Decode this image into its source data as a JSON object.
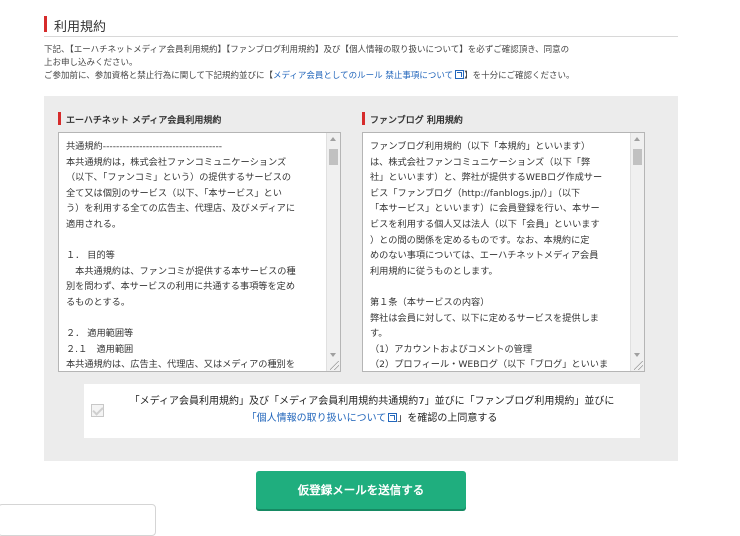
{
  "section": {
    "title": "利用規約"
  },
  "notice": {
    "line1": "下記、【エーハチネットメディア会員利用規約】【ファンブログ利用規約】及び【個人情報の取り扱いについて】を必ずご確認頂き、同意の",
    "line2": "上お申し込みください。",
    "line3_prefix": "ご参加前に、参加資格と禁止行為に関して下記規約並びに【",
    "line3_link": "メディア会員としてのルール 禁止事項について",
    "line3_suffix": "】を十分にご確認ください。"
  },
  "terms_left": {
    "heading": "エーハチネット メディア会員利用規約",
    "body": "共通規約------------------------------------\n本共通規約は，株式会社ファンコミュニケーションズ\n（以下、「ファンコミ」という）の提供するサービスの\n全て又は個別のサービス（以下、「本サービス」とい\nう）を利用する全ての広告主、代理店、及びメディアに\n適用される。\n\n１． 目的等\n　本共通規約は、ファンコミが提供する本サービスの種\n別を問わず、本サービスの利用に共通する事項等を定め\nるものとする。\n\n２． 適用範囲等\n２.１　適用範囲\n本共通規約は、広告主、代理店、又はメディアの種別を\n問わず本サービスの一切の利用者（以下、「利用者」と"
  },
  "terms_right": {
    "heading": "ファンブログ 利用規約",
    "body": "ファンブログ利用規約（以下「本規約」といいます）\nは、株式会社ファンコミュニケーションズ（以下「弊\n社」といいます）と、弊社が提供するWEBログ作成サー\nビス「ファンブログ（http://fanblogs.jp/）」（以下\n「本サービス」といいます）に会員登録を行い、本サー\nビスを利用する個人又は法人（以下「会員」といいます\n）との間の関係を定めるものです。なお、本規約に定\nめのない事項については、エーハチネットメディア会員\n利用規約に従うものとします。\n\n第１条（本サービスの内容）\n弊社は会員に対して、以下に定めるサービスを提供しま\nす。\n（1）アカウントおよびコメントの管理\n（2）プロフィール・WEBログ（以下「ブログ」といいま\nす）の記事投稿および編集など"
  },
  "agreement": {
    "part1": "「メディア会員利用規約」及び「メディア会員利用規約共通規約7」並びに「ファンブログ利用規約」並びに",
    "link": "「個人情報の取り扱いについて",
    "part2": "」を確認の上同意する",
    "checked": true
  },
  "submit": {
    "label": "仮登録メールを送信する"
  }
}
